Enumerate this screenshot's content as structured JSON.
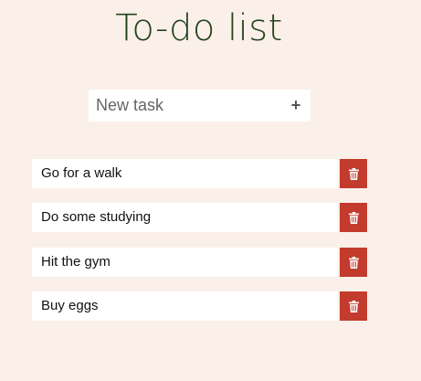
{
  "app": {
    "title": "To-do list"
  },
  "new_task": {
    "placeholder": "New task",
    "value": "",
    "add_label": "+"
  },
  "tasks": [
    {
      "label": "Go for a walk",
      "delete_icon": "trash-icon"
    },
    {
      "label": "Do some studying",
      "delete_icon": "trash-icon"
    },
    {
      "label": "Hit the gym",
      "delete_icon": "trash-icon"
    },
    {
      "label": "Buy eggs",
      "delete_icon": "trash-icon"
    }
  ],
  "colors": {
    "background": "#faf0e9",
    "title": "#25421d",
    "delete_button": "#c33b2d",
    "card": "#ffffff"
  }
}
